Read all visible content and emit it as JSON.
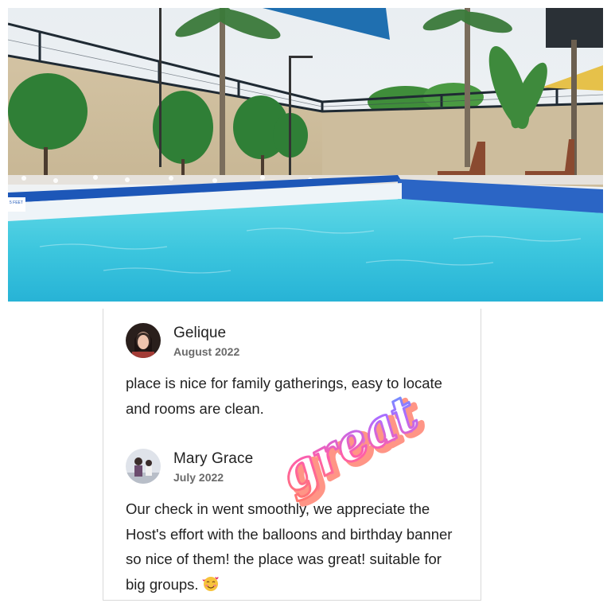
{
  "reviews": [
    {
      "name": "Gelique",
      "date": "August 2022",
      "text": "place is nice for family gatherings, easy to locate and rooms are clean."
    },
    {
      "name": "Mary Grace",
      "date": "July 2022",
      "text": "Our check in went smoothly, we appreciate the Host's effort with the balloons and birthday banner so nice of them! the place was great! suitable for big groups.",
      "emoji": "smiling-face-with-hearts"
    }
  ],
  "sticker": {
    "text": "great"
  },
  "photo": {
    "depth_marker": "5 FEET"
  }
}
